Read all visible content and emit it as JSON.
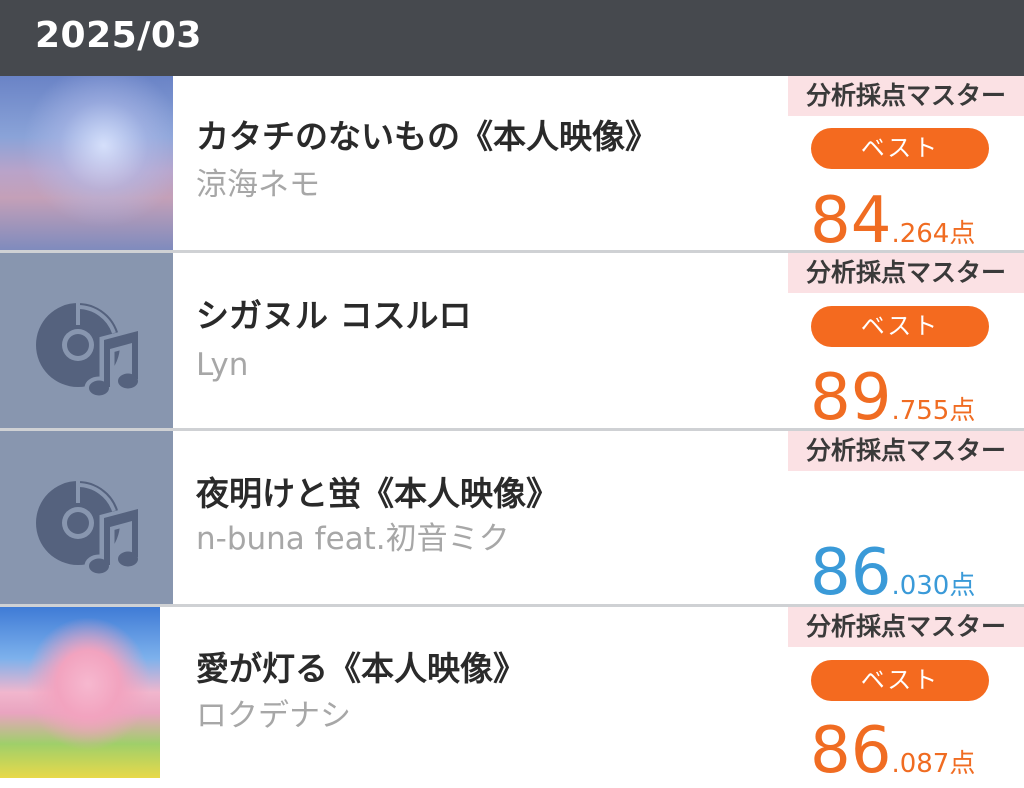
{
  "header": {
    "title": "2025/03"
  },
  "colors": {
    "header_bg": "#46494e",
    "best_badge": "#f46a1f",
    "score_orange": "#f06c22",
    "score_blue": "#3a9ad8",
    "mode_badge_bg": "#fbe1e4"
  },
  "entries": [
    {
      "title": "カタチのないもの《本人映像》",
      "artist": "涼海ネモ",
      "mode": "分析採点マスター",
      "best": "ベスト",
      "score_int": "84",
      "score_dec": ".264",
      "unit": "点",
      "thumbnail": "album-art"
    },
    {
      "title": "シガヌル コスルロ",
      "artist": "Lyn",
      "mode": "分析採点マスター",
      "best": "ベスト",
      "score_int": "89",
      "score_dec": ".755",
      "unit": "点",
      "thumbnail": "disc-music-icon"
    },
    {
      "title": "夜明けと蛍《本人映像》",
      "artist": "n-buna feat.初音ミク",
      "mode": "分析採点マスター",
      "score_int": "86",
      "score_dec": ".030",
      "unit": "点",
      "thumbnail": "disc-music-icon"
    },
    {
      "title": "愛が灯る《本人映像》",
      "artist": "ロクデナシ",
      "mode": "分析採点マスター",
      "best": "ベスト",
      "score_int": "86",
      "score_dec": ".087",
      "unit": "点",
      "thumbnail": "album-art"
    }
  ]
}
